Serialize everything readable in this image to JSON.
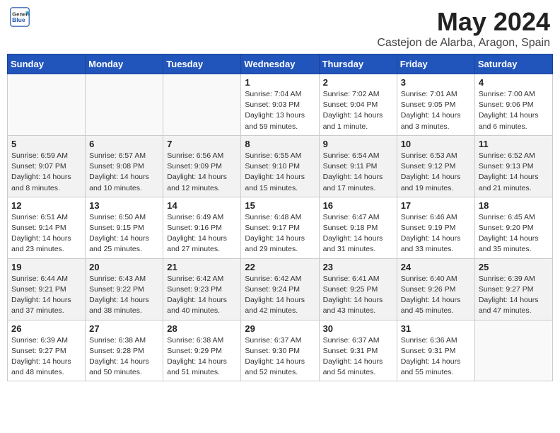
{
  "header": {
    "logo_general": "General",
    "logo_blue": "Blue",
    "month_year": "May 2024",
    "location": "Castejon de Alarba, Aragon, Spain"
  },
  "weekdays": [
    "Sunday",
    "Monday",
    "Tuesday",
    "Wednesday",
    "Thursday",
    "Friday",
    "Saturday"
  ],
  "weeks": [
    {
      "shade": false,
      "days": [
        {
          "num": "",
          "info": ""
        },
        {
          "num": "",
          "info": ""
        },
        {
          "num": "",
          "info": ""
        },
        {
          "num": "1",
          "info": "Sunrise: 7:04 AM\nSunset: 9:03 PM\nDaylight: 13 hours\nand 59 minutes."
        },
        {
          "num": "2",
          "info": "Sunrise: 7:02 AM\nSunset: 9:04 PM\nDaylight: 14 hours\nand 1 minute."
        },
        {
          "num": "3",
          "info": "Sunrise: 7:01 AM\nSunset: 9:05 PM\nDaylight: 14 hours\nand 3 minutes."
        },
        {
          "num": "4",
          "info": "Sunrise: 7:00 AM\nSunset: 9:06 PM\nDaylight: 14 hours\nand 6 minutes."
        }
      ]
    },
    {
      "shade": true,
      "days": [
        {
          "num": "5",
          "info": "Sunrise: 6:59 AM\nSunset: 9:07 PM\nDaylight: 14 hours\nand 8 minutes."
        },
        {
          "num": "6",
          "info": "Sunrise: 6:57 AM\nSunset: 9:08 PM\nDaylight: 14 hours\nand 10 minutes."
        },
        {
          "num": "7",
          "info": "Sunrise: 6:56 AM\nSunset: 9:09 PM\nDaylight: 14 hours\nand 12 minutes."
        },
        {
          "num": "8",
          "info": "Sunrise: 6:55 AM\nSunset: 9:10 PM\nDaylight: 14 hours\nand 15 minutes."
        },
        {
          "num": "9",
          "info": "Sunrise: 6:54 AM\nSunset: 9:11 PM\nDaylight: 14 hours\nand 17 minutes."
        },
        {
          "num": "10",
          "info": "Sunrise: 6:53 AM\nSunset: 9:12 PM\nDaylight: 14 hours\nand 19 minutes."
        },
        {
          "num": "11",
          "info": "Sunrise: 6:52 AM\nSunset: 9:13 PM\nDaylight: 14 hours\nand 21 minutes."
        }
      ]
    },
    {
      "shade": false,
      "days": [
        {
          "num": "12",
          "info": "Sunrise: 6:51 AM\nSunset: 9:14 PM\nDaylight: 14 hours\nand 23 minutes."
        },
        {
          "num": "13",
          "info": "Sunrise: 6:50 AM\nSunset: 9:15 PM\nDaylight: 14 hours\nand 25 minutes."
        },
        {
          "num": "14",
          "info": "Sunrise: 6:49 AM\nSunset: 9:16 PM\nDaylight: 14 hours\nand 27 minutes."
        },
        {
          "num": "15",
          "info": "Sunrise: 6:48 AM\nSunset: 9:17 PM\nDaylight: 14 hours\nand 29 minutes."
        },
        {
          "num": "16",
          "info": "Sunrise: 6:47 AM\nSunset: 9:18 PM\nDaylight: 14 hours\nand 31 minutes."
        },
        {
          "num": "17",
          "info": "Sunrise: 6:46 AM\nSunset: 9:19 PM\nDaylight: 14 hours\nand 33 minutes."
        },
        {
          "num": "18",
          "info": "Sunrise: 6:45 AM\nSunset: 9:20 PM\nDaylight: 14 hours\nand 35 minutes."
        }
      ]
    },
    {
      "shade": true,
      "days": [
        {
          "num": "19",
          "info": "Sunrise: 6:44 AM\nSunset: 9:21 PM\nDaylight: 14 hours\nand 37 minutes."
        },
        {
          "num": "20",
          "info": "Sunrise: 6:43 AM\nSunset: 9:22 PM\nDaylight: 14 hours\nand 38 minutes."
        },
        {
          "num": "21",
          "info": "Sunrise: 6:42 AM\nSunset: 9:23 PM\nDaylight: 14 hours\nand 40 minutes."
        },
        {
          "num": "22",
          "info": "Sunrise: 6:42 AM\nSunset: 9:24 PM\nDaylight: 14 hours\nand 42 minutes."
        },
        {
          "num": "23",
          "info": "Sunrise: 6:41 AM\nSunset: 9:25 PM\nDaylight: 14 hours\nand 43 minutes."
        },
        {
          "num": "24",
          "info": "Sunrise: 6:40 AM\nSunset: 9:26 PM\nDaylight: 14 hours\nand 45 minutes."
        },
        {
          "num": "25",
          "info": "Sunrise: 6:39 AM\nSunset: 9:27 PM\nDaylight: 14 hours\nand 47 minutes."
        }
      ]
    },
    {
      "shade": false,
      "days": [
        {
          "num": "26",
          "info": "Sunrise: 6:39 AM\nSunset: 9:27 PM\nDaylight: 14 hours\nand 48 minutes."
        },
        {
          "num": "27",
          "info": "Sunrise: 6:38 AM\nSunset: 9:28 PM\nDaylight: 14 hours\nand 50 minutes."
        },
        {
          "num": "28",
          "info": "Sunrise: 6:38 AM\nSunset: 9:29 PM\nDaylight: 14 hours\nand 51 minutes."
        },
        {
          "num": "29",
          "info": "Sunrise: 6:37 AM\nSunset: 9:30 PM\nDaylight: 14 hours\nand 52 minutes."
        },
        {
          "num": "30",
          "info": "Sunrise: 6:37 AM\nSunset: 9:31 PM\nDaylight: 14 hours\nand 54 minutes."
        },
        {
          "num": "31",
          "info": "Sunrise: 6:36 AM\nSunset: 9:31 PM\nDaylight: 14 hours\nand 55 minutes."
        },
        {
          "num": "",
          "info": ""
        }
      ]
    }
  ]
}
